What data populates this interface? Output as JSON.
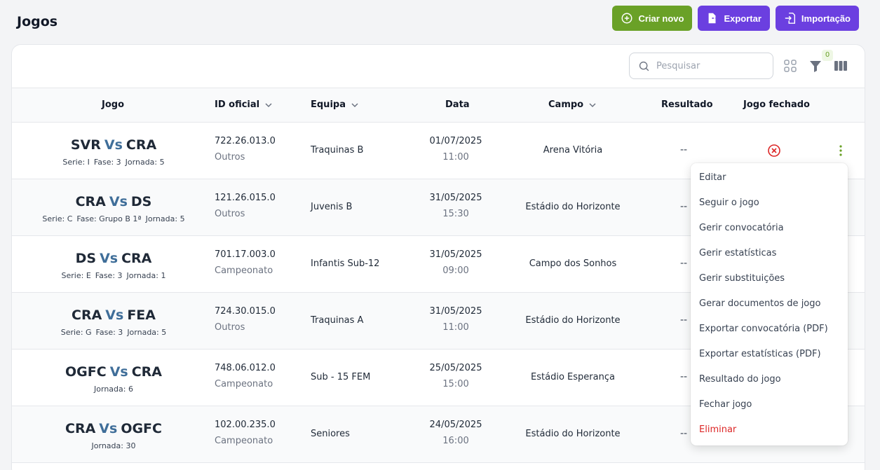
{
  "page": {
    "title": "Jogos"
  },
  "actions": {
    "create": "Criar novo",
    "export": "Exportar",
    "import": "Importação"
  },
  "toolbar": {
    "search_placeholder": "Pesquisar",
    "filter_count": "0"
  },
  "columns": {
    "jogo": "Jogo",
    "id_oficial": "ID oficial",
    "equipa": "Equipa",
    "data": "Data",
    "campo": "Campo",
    "resultado": "Resultado",
    "jogo_fechado": "Jogo fechado"
  },
  "rows": [
    {
      "home": "SVR",
      "vs": "Vs",
      "away": "CRA",
      "meta": [
        "Serie: I",
        "Fase: 3",
        "Jornada: 5"
      ],
      "id": "722.26.013.0",
      "competition": "Outros",
      "team": "Traquinas B",
      "date": "01/07/2025",
      "time": "11:00",
      "field": "Arena Vitória",
      "result": "--"
    },
    {
      "home": "CRA",
      "vs": "Vs",
      "away": "DS",
      "meta": [
        "Serie: C",
        "Fase: Grupo B 1ª",
        "Jornada: 5"
      ],
      "id": "121.26.015.0",
      "competition": "Outros",
      "team": "Juvenis B",
      "date": "31/05/2025",
      "time": "15:30",
      "field": "Estádio do Horizonte",
      "result": "--"
    },
    {
      "home": "DS",
      "vs": "Vs",
      "away": "CRA",
      "meta": [
        "Serie: E",
        "Fase: 3",
        "Jornada: 1"
      ],
      "id": "701.17.003.0",
      "competition": "Campeonato",
      "team": "Infantis Sub-12",
      "date": "31/05/2025",
      "time": "09:00",
      "field": "Campo dos Sonhos",
      "result": "--"
    },
    {
      "home": "CRA",
      "vs": "Vs",
      "away": "FEA",
      "meta": [
        "Serie: G",
        "Fase: 3",
        "Jornada: 5"
      ],
      "id": "724.30.015.0",
      "competition": "Outros",
      "team": "Traquinas A",
      "date": "31/05/2025",
      "time": "11:00",
      "field": "Estádio do Horizonte",
      "result": "--"
    },
    {
      "home": "OGFC",
      "vs": "Vs",
      "away": "CRA",
      "meta": [
        "Jornada: 6"
      ],
      "id": "748.06.012.0",
      "competition": "Campeonato",
      "team": "Sub - 15 FEM",
      "date": "25/05/2025",
      "time": "15:00",
      "field": "Estádio Esperança",
      "result": "--"
    },
    {
      "home": "CRA",
      "vs": "Vs",
      "away": "OGFC",
      "meta": [
        "Jornada: 30"
      ],
      "id": "102.00.235.0",
      "competition": "Campeonato",
      "team": "Seniores",
      "date": "24/05/2025",
      "time": "16:00",
      "field": "Estádio do Horizonte",
      "result": "--"
    }
  ],
  "context_menu": {
    "items": [
      {
        "label": "Editar",
        "danger": false
      },
      {
        "label": "Seguir o jogo",
        "danger": false
      },
      {
        "label": "Gerir convocatória",
        "danger": false
      },
      {
        "label": "Gerir estatísticas",
        "danger": false
      },
      {
        "label": "Gerir substituições",
        "danger": false
      },
      {
        "label": "Gerar documentos de jogo",
        "danger": false
      },
      {
        "label": "Exportar convocatória (PDF)",
        "danger": false
      },
      {
        "label": "Exportar estatísticas (PDF)",
        "danger": false
      },
      {
        "label": "Resultado do jogo",
        "danger": false
      },
      {
        "label": "Fechar jogo",
        "danger": false
      },
      {
        "label": "Eliminar",
        "danger": true
      }
    ]
  },
  "colors": {
    "green": "#6aa127",
    "purple": "#6b3fe0",
    "vs": "#3f6e99",
    "danger": "#dc2626"
  },
  "icons": {
    "create": "plus-circle-icon",
    "export": "export-icon",
    "import": "import-icon",
    "closed": "x-circle-icon",
    "row_actions": "kebab-icon"
  }
}
